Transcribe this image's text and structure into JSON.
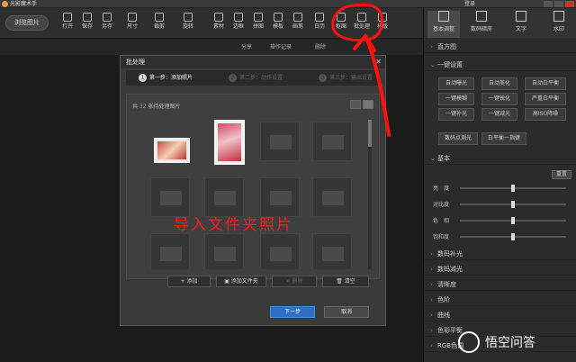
{
  "app": {
    "title": "光影魔术手",
    "login": "登录"
  },
  "toolbar": {
    "browse": "浏览图片",
    "tools": [
      {
        "label": "打开",
        "icon": "folder-icon"
      },
      {
        "label": "保存",
        "icon": "save-icon"
      },
      {
        "label": "另存",
        "icon": "save-as-icon"
      },
      {
        "label": "尺寸",
        "icon": "resize-icon"
      },
      {
        "label": "裁剪",
        "icon": "crop-icon"
      },
      {
        "label": "旋转",
        "icon": "rotate-icon"
      },
      {
        "label": "素材",
        "icon": "material-icon"
      },
      {
        "label": "边框",
        "icon": "frame-icon"
      },
      {
        "label": "拼图",
        "icon": "collage-icon"
      },
      {
        "label": "模板",
        "icon": "template-icon"
      },
      {
        "label": "画笔",
        "icon": "brush-icon"
      },
      {
        "label": "日历",
        "icon": "calendar-icon"
      },
      {
        "label": "抠图",
        "icon": "cutout-icon"
      },
      {
        "label": "批处理",
        "icon": "batch-icon"
      },
      {
        "label": "排版",
        "icon": "layout-icon"
      }
    ]
  },
  "subbar": {
    "share": "分享",
    "history": "操作记录",
    "delete": "删除"
  },
  "right_panel": {
    "tabs": [
      "基本调整",
      "数码暗房",
      "文字",
      "水印"
    ],
    "sections": {
      "histogram": "直方图",
      "one_click": "一键设置",
      "basic": "基本",
      "digital_fill": "数码补光",
      "digital_reduce": "数码减光",
      "clarity": "清晰度",
      "levels": "色阶",
      "curves": "曲线",
      "color_balance": "色彩平衡",
      "rgb": "RGB色调"
    },
    "one_click_buttons": [
      "自动曝光",
      "自动美化",
      "自动白平衡",
      "一键模糊",
      "一键锐化",
      "严重白平衡",
      "一键补光",
      "一键减光",
      "高ISO降噪",
      "数码点测光",
      "白平衡一指键"
    ],
    "reset": "重置",
    "sliders": [
      {
        "label": "亮　度",
        "value": 0.5
      },
      {
        "label": "对比度",
        "value": 0.5
      },
      {
        "label": "色　相",
        "value": 0.5
      },
      {
        "label": "饱和度",
        "value": 0.5
      }
    ]
  },
  "dialog": {
    "title": "批处理",
    "steps": [
      "第一步：添加照片",
      "第二步：动作设置",
      "第三步：输出设置"
    ],
    "count_prefix": "共",
    "count": "32",
    "count_suffix": "张待处理图片",
    "buttons": {
      "add": "添加",
      "add_folder": "添加文件夹",
      "remove": "删除",
      "clear": "清空"
    },
    "next": "下一步",
    "cancel": "取消"
  },
  "annotation": {
    "text": "导入文件夹照片",
    "color": "#ff1a1a"
  },
  "watermark": {
    "text": "悟空问答"
  }
}
